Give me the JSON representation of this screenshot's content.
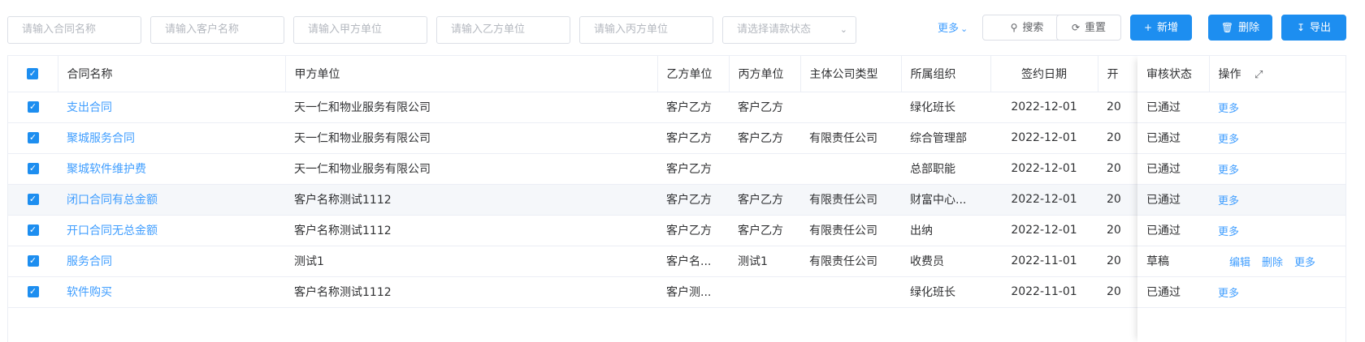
{
  "filters": {
    "contract_name": "请输入合同名称",
    "customer_name": "请输入客户名称",
    "party_a": "请输入甲方单位",
    "party_b": "请输入乙方单位",
    "party_c": "请输入丙方单位",
    "payment_status": "请选择请款状态"
  },
  "toolbar": {
    "more": "更多",
    "search": "搜索",
    "reset": "重置",
    "add": "新增",
    "delete": "删除",
    "export": "导出"
  },
  "columns": {
    "name": "合同名称",
    "party_a": "甲方单位",
    "party_b": "乙方单位",
    "party_c": "丙方单位",
    "company_type": "主体公司类型",
    "org": "所属组织",
    "sign_date": "签约日期",
    "partial": "开",
    "review_status": "审核状态",
    "actions": "操作"
  },
  "rows": [
    {
      "name": "支出合同",
      "party_a": "天一仁和物业服务有限公司",
      "party_b": "客户乙方",
      "party_c": "客户乙方",
      "company_type": "",
      "org": "绿化班长",
      "sign_date": "2022-12-01",
      "partial": "20",
      "status": "已通过",
      "actions": [
        "更多"
      ]
    },
    {
      "name": "聚城服务合同",
      "party_a": "天一仁和物业服务有限公司",
      "party_b": "客户乙方",
      "party_c": "客户乙方",
      "company_type": "有限责任公司",
      "org": "综合管理部",
      "sign_date": "2022-12-01",
      "partial": "20",
      "status": "已通过",
      "actions": [
        "更多"
      ]
    },
    {
      "name": "聚城软件维护费",
      "party_a": "天一仁和物业服务有限公司",
      "party_b": "客户乙方",
      "party_c": "",
      "company_type": "",
      "org": "总部职能",
      "sign_date": "2022-12-01",
      "partial": "20",
      "status": "已通过",
      "actions": [
        "更多"
      ]
    },
    {
      "name": "闭口合同有总金额",
      "party_a": "客户名称测试1112",
      "party_b": "客户乙方",
      "party_c": "客户乙方",
      "company_type": "有限责任公司",
      "org": "财富中心...",
      "sign_date": "2022-12-01",
      "partial": "20",
      "status": "已通过",
      "actions": [
        "更多"
      ]
    },
    {
      "name": "开口合同无总金额",
      "party_a": "客户名称测试1112",
      "party_b": "客户乙方",
      "party_c": "客户乙方",
      "company_type": "有限责任公司",
      "org": "出纳",
      "sign_date": "2022-12-01",
      "partial": "20",
      "status": "已通过",
      "actions": [
        "更多"
      ]
    },
    {
      "name": "服务合同",
      "party_a": "测试1",
      "party_b": "客户名...",
      "party_c": "测试1",
      "company_type": "有限责任公司",
      "org": "收费员",
      "sign_date": "2022-11-01",
      "partial": "20",
      "status": "草稿",
      "actions": [
        "编辑",
        "删除",
        "更多"
      ]
    },
    {
      "name": "软件购买",
      "party_a": "客户名称测试1112",
      "party_b": "客户测...",
      "party_c": "",
      "company_type": "",
      "org": "绿化班长",
      "sign_date": "2022-11-01",
      "partial": "20",
      "status": "已通过",
      "actions": [
        "更多"
      ]
    }
  ],
  "colors": {
    "primary": "#1d8ef0",
    "link": "#409eff",
    "border": "#dcdfe6"
  }
}
